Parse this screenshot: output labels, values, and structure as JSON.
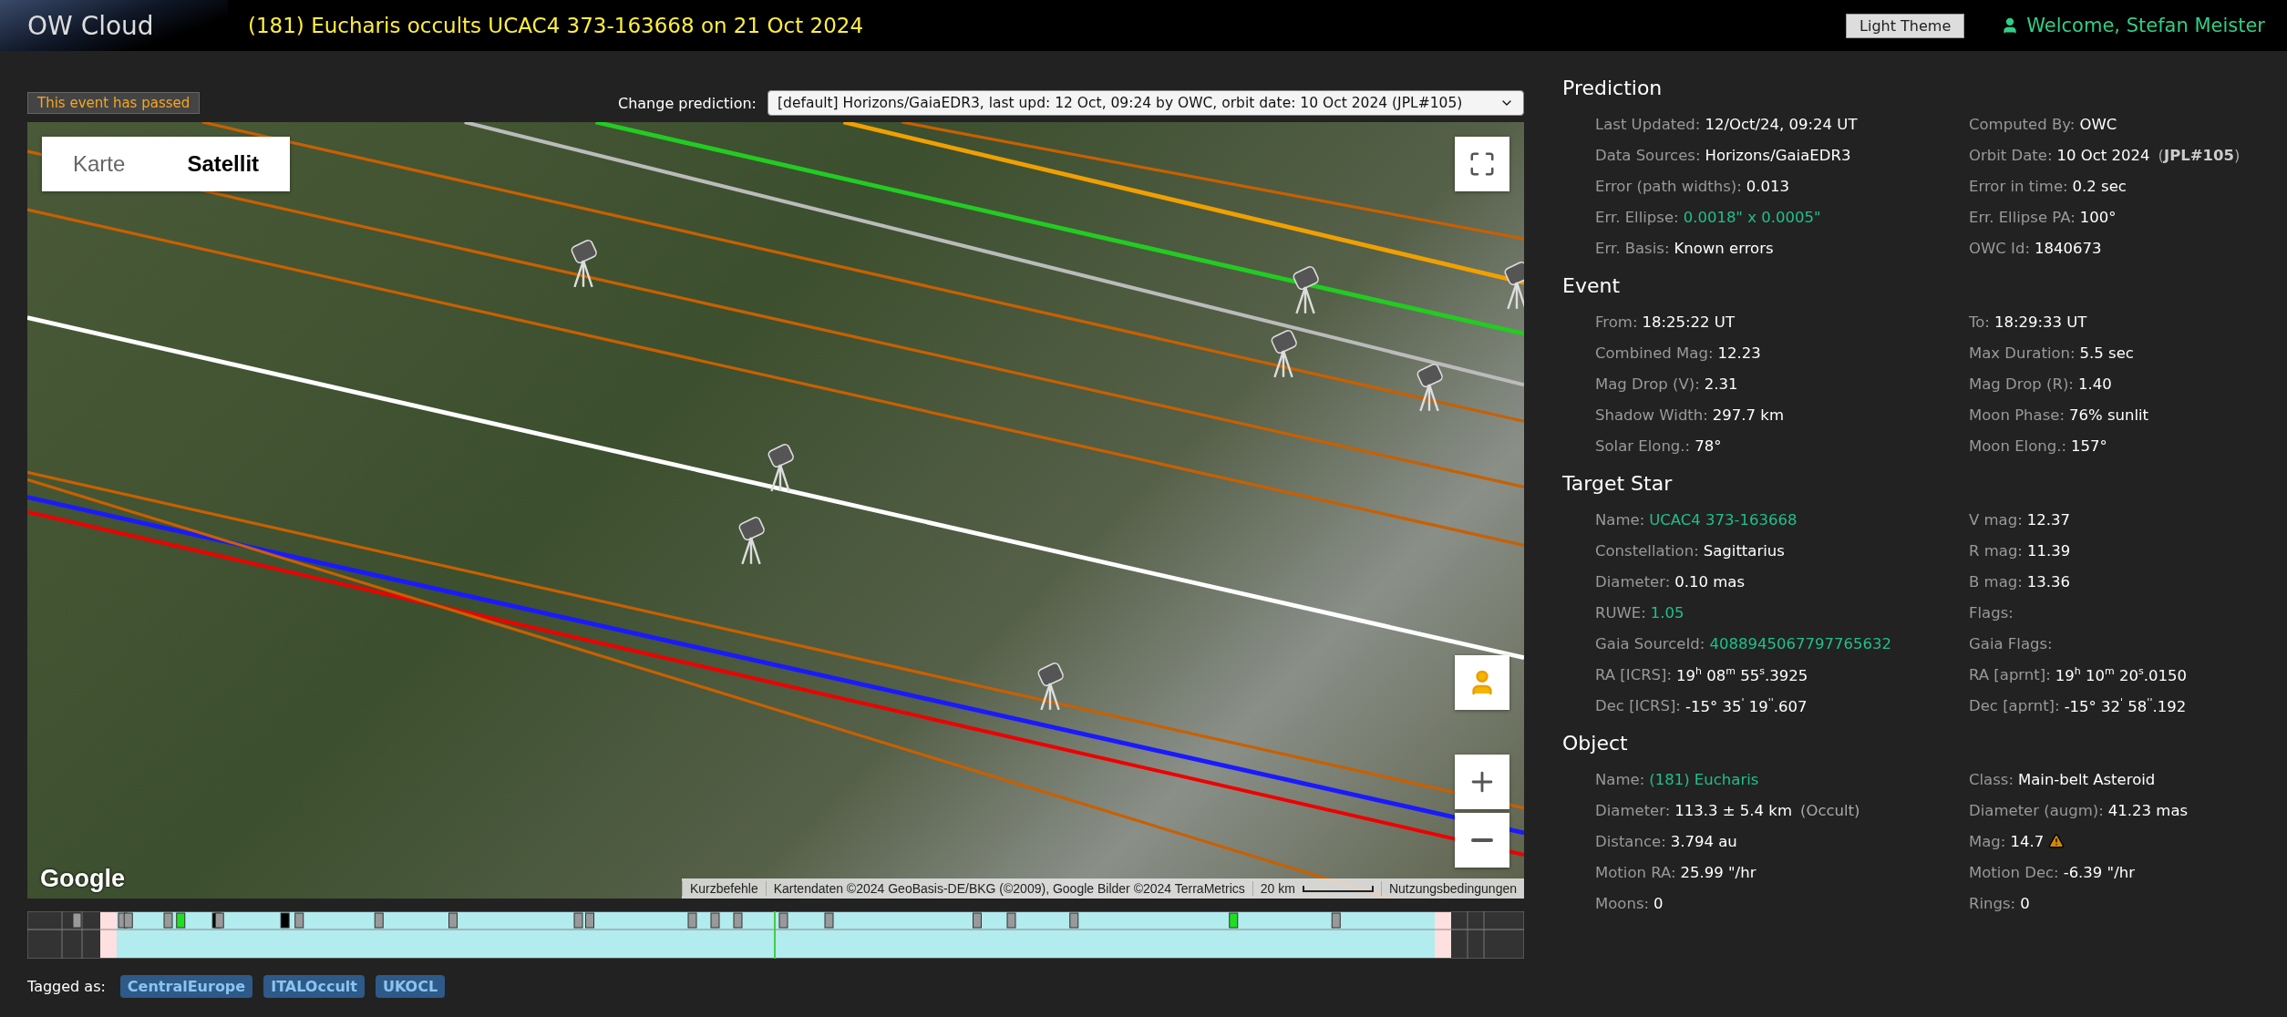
{
  "header": {
    "logo": "OW Cloud",
    "title": "(181) Eucharis occults UCAC4 373-163668 on 21 Oct 2024",
    "theme_button": "Light Theme",
    "welcome": "Welcome, Stefan Meister"
  },
  "status_badge": "This event has passed",
  "prediction_select": {
    "label": "Change prediction:",
    "value": "[default] Horizons/GaiaEDR3, last upd: 12 Oct, 09:24 by OWC, orbit date: 10 Oct 2024 (JPL#105)"
  },
  "map": {
    "map_types": [
      {
        "label": "Karte",
        "selected": false
      },
      {
        "label": "Satellit",
        "selected": true
      }
    ],
    "logo": "Google",
    "attribution": [
      "Kurzbefehle",
      "Kartendaten ©2024 GeoBasis-DE/BKG (©2009), Google Bilder ©2024 TerraMetrics"
    ],
    "scale": "20 km",
    "terms": "Nutzungsbedingungen"
  },
  "tags_label": "Tagged as:",
  "tags": [
    "CentralEurope",
    "ITALOccult",
    "UKOCL"
  ],
  "sections": [
    {
      "title": "Prediction",
      "left": [
        {
          "label": "Last Updated:",
          "value": "12/Oct/24, 09:24 UT",
          "kind": "text"
        },
        {
          "label": "Data Sources:",
          "value": "Horizons/GaiaEDR3",
          "kind": "text"
        },
        {
          "label": "Error (path widths):",
          "value": "0.013",
          "kind": "text"
        },
        {
          "label": "Err. Ellipse:",
          "value": "0.0018\" x 0.0005\"",
          "kind": "link"
        },
        {
          "label": "Err. Basis:",
          "value": "Known errors",
          "kind": "text"
        }
      ],
      "right": [
        {
          "label": "Computed By:",
          "value": "OWC",
          "kind": "text"
        },
        {
          "label": "Orbit Date:",
          "value": "10 Oct 2024",
          "note": "(**JPL#105**)",
          "kind": "text"
        },
        {
          "label": "Error in time:",
          "value": "0.2 sec",
          "kind": "text"
        },
        {
          "label": "Err. Ellipse PA:",
          "value": "100°",
          "kind": "text"
        },
        {
          "label": "OWC Id:",
          "value": "1840673",
          "kind": "text"
        }
      ]
    },
    {
      "title": "Event",
      "left": [
        {
          "label": "From:",
          "value": "18:25:22 UT",
          "kind": "text"
        },
        {
          "label": "Combined Mag:",
          "value": "12.23",
          "kind": "text"
        },
        {
          "label": "Mag Drop (V):",
          "value": "2.31",
          "kind": "text"
        },
        {
          "label": "Shadow Width:",
          "value": "297.7 km",
          "kind": "text"
        },
        {
          "label": "Solar Elong.:",
          "value": "78°",
          "kind": "text"
        }
      ],
      "right": [
        {
          "label": "To:",
          "value": "18:29:33 UT",
          "kind": "text"
        },
        {
          "label": "Max Duration:",
          "value": "5.5 sec",
          "kind": "text"
        },
        {
          "label": "Mag Drop (R):",
          "value": "1.40",
          "kind": "text"
        },
        {
          "label": "Moon Phase:",
          "value": "76% sunlit",
          "kind": "text"
        },
        {
          "label": "Moon Elong.:",
          "value": "157°",
          "kind": "text"
        }
      ]
    },
    {
      "title": "Target Star",
      "left": [
        {
          "label": "Name:",
          "value": "UCAC4 373-163668",
          "kind": "link"
        },
        {
          "label": "Constellation:",
          "value": "Sagittarius",
          "kind": "text"
        },
        {
          "label": "Diameter:",
          "value": "0.10 mas",
          "kind": "text"
        },
        {
          "label": "RUWE:",
          "value": "1.05",
          "kind": "link"
        },
        {
          "label": "Gaia SourceId:",
          "value": "4088945067797765632",
          "kind": "link"
        },
        {
          "label": "RA [ICRS]:",
          "value": "19$^{h}$ 08$^{m}$ 55$^{s}$.3925",
          "kind": "text"
        },
        {
          "label": "Dec [ICRS]:",
          "value": "-15° 35$^{'}$ 19$^{''}$.607",
          "kind": "text"
        }
      ],
      "right": [
        {
          "label": "V mag:",
          "value": "12.37",
          "kind": "text"
        },
        {
          "label": "R mag:",
          "value": "11.39",
          "kind": "text"
        },
        {
          "label": "B mag:",
          "value": "13.36",
          "kind": "text"
        },
        {
          "label": "Flags:",
          "kind": "text"
        },
        {
          "label": "Gaia Flags:",
          "kind": "text"
        },
        {
          "label": "RA [aprnt]:",
          "value": "19$^{h}$ 10$^{m}$ 20$^{s}$.0150",
          "kind": "text"
        },
        {
          "label": "Dec [aprnt]:",
          "value": "-15° 32$^{'}$ 58$^{''}$.192",
          "kind": "text"
        }
      ]
    },
    {
      "title": "Object",
      "left": [
        {
          "label": "Name:",
          "value": "(181) Eucharis",
          "kind": "link"
        },
        {
          "label": "Diameter:",
          "value": "113.3 ± 5.4 km",
          "note": "(Occult)",
          "kind": "text"
        },
        {
          "label": "Distance:",
          "value": "3.794 au",
          "kind": "text"
        },
        {
          "label": "Motion RA:",
          "value": "25.99 \"/hr",
          "kind": "text"
        },
        {
          "label": "Moons:",
          "value": "0",
          "kind": "text"
        }
      ],
      "right": [
        {
          "label": "Class:",
          "value": "Main-belt Asteroid",
          "kind": "text"
        },
        {
          "label": "Diameter (augm):",
          "value": "41.23 mas",
          "kind": "text"
        },
        {
          "label": "Mag:",
          "value": "14.7",
          "kind": "warning"
        },
        {
          "label": "Motion Dec:",
          "value": "-6.39 \"/hr",
          "kind": "text"
        },
        {
          "label": "Rings:",
          "value": "0",
          "kind": "text"
        }
      ]
    }
  ]
}
